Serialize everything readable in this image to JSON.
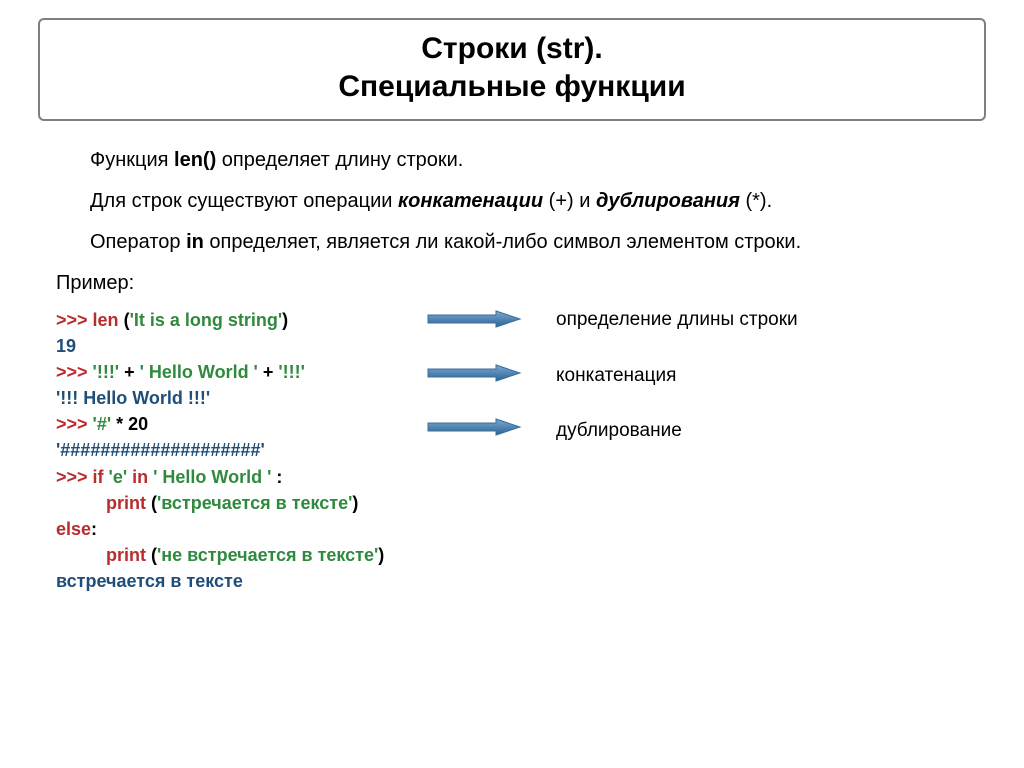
{
  "title_line1": "Строки (str).",
  "title_line2": "Специальные функции",
  "p1_pre": "Функция ",
  "p1_bold": "len()",
  "p1_post": " определяет длину строки.",
  "p2_pre": "Для строк существуют операции ",
  "p2_b1": "конкатенации",
  "p2_mid": " (+) и ",
  "p2_b2": "дублирования",
  "p2_post": " (*).",
  "p3_pre": "Оператор ",
  "p3_bold": "in",
  "p3_post": " определяет, является ли какой-либо символ элементом строки.",
  "example_label": "Пример:",
  "code": {
    "l1_prompt": ">>> ",
    "l1_func": "len ",
    "l1_paren_open": "(",
    "l1_str": "'It is a long string'",
    "l1_paren_close": ")",
    "l2": "19",
    "l3_prompt": ">>> ",
    "l3_s1": "'!!!'",
    "l3_plus1": " + ",
    "l3_s2": "' Hello World '",
    "l3_plus2": " + ",
    "l3_s3": "'!!!'",
    "l4": "'!!! Hello World !!!'",
    "l5_prompt": ">>> ",
    "l5_s1": "'#'",
    "l5_op": " * 20",
    "l6": "'####################'",
    "l7_prompt": ">>> ",
    "l7_if": "if  ",
    "l7_s1": "'e'",
    "l7_in": "  in  ",
    "l7_s2": "' Hello World '",
    "l7_colon": " :",
    "l8_indent": "          ",
    "l8_func": "print ",
    "l8_open": "(",
    "l8_str": "'встречается в тексте'",
    "l8_close": ")",
    "l9_else": "else",
    "l9_colon": ":",
    "l10_indent": "          ",
    "l10_func": "print ",
    "l10_open": "(",
    "l10_str": "'не встречается в тексте'",
    "l10_close": ")",
    "l11": "встречается в тексте"
  },
  "notes": {
    "n1": "определение длины строки",
    "n2": "конкатенация",
    "n3": "дублирование"
  }
}
